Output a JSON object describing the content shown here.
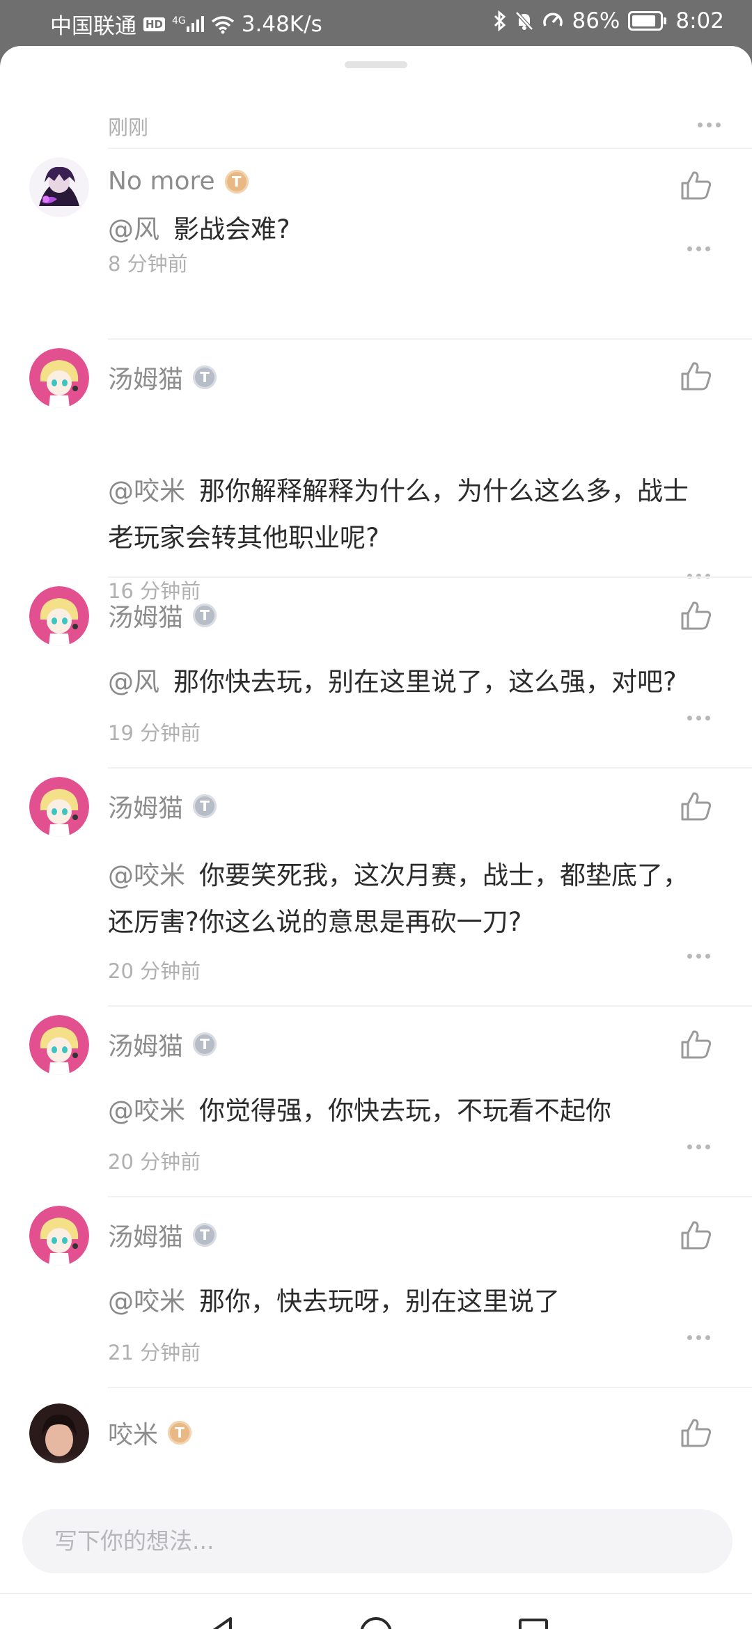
{
  "status_bar": {
    "carrier": "中国联通",
    "hd": "HD",
    "network": "4G",
    "speed": "3.48K/s",
    "battery": "86%",
    "battery_level": 0.86,
    "time": "8:02"
  },
  "thread_header": {
    "time": "刚刚"
  },
  "comments": [
    {
      "name": "No more",
      "badge": "T",
      "badge_color": "gold",
      "mention": "@风",
      "text": "影战会难?",
      "time": "8 分钟前",
      "avatar": "dark-character-avatar"
    },
    {
      "name": "汤姆猫",
      "badge": "T",
      "badge_color": "silver",
      "mention": "@咬米",
      "text": "那你解释解释为什么，为什么这么多，战士老玩家会转其他职业呢?",
      "time": "16 分钟前",
      "avatar": "anime-girl-avatar"
    },
    {
      "name": "汤姆猫",
      "badge": "T",
      "badge_color": "silver",
      "mention": "@风",
      "text": "那你快去玩，别在这里说了，这么强，对吧?",
      "time": "19 分钟前",
      "avatar": "anime-girl-avatar"
    },
    {
      "name": "汤姆猫",
      "badge": "T",
      "badge_color": "silver",
      "mention": "@咬米",
      "text": "你要笑死我，这次月赛，战士，都垫底了，还厉害?你这么说的意思是再砍一刀?",
      "time": "20 分钟前",
      "avatar": "anime-girl-avatar"
    },
    {
      "name": "汤姆猫",
      "badge": "T",
      "badge_color": "silver",
      "mention": "@咬米",
      "text": "你觉得强，你快去玩，不玩看不起你",
      "time": "20 分钟前",
      "avatar": "anime-girl-avatar"
    },
    {
      "name": "汤姆猫",
      "badge": "T",
      "badge_color": "silver",
      "mention": "@咬米",
      "text": "那你，快去玩呀，别在这里说了",
      "time": "21 分钟前",
      "avatar": "anime-girl-avatar"
    },
    {
      "name": "咬米",
      "badge": "T",
      "badge_color": "gold",
      "avatar": "photo-avatar"
    }
  ],
  "input": {
    "placeholder": "写下你的想法..."
  },
  "colors": {
    "accent_gold": "#e8b984",
    "badge_silver": "#b7bdc7",
    "text_primary": "#2b2b2b",
    "text_secondary": "#8d8d8d"
  }
}
